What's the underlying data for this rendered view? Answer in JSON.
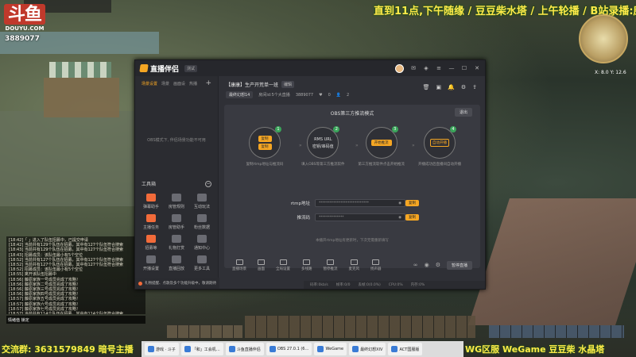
{
  "overlay": {
    "logo_big": "斗鱼",
    "logo_small": "DOUYU.COM",
    "room_id": "3889077",
    "ticker": "直到11点,下午随缘 / 豆豆柴水塔 / 上午轮播 / B站录播:康",
    "bottom_left": "交流群: 3631579849 暗号主播",
    "bottom_right": "WG区服 WeGame 豆豆柴 水晶塔",
    "coords": "X: 8.0 Y: 12.6"
  },
  "chat": {
    "lines": [
      "[18:42]「 」进入了队伍招募中，已提交申请",
      "[18:42] 当前共有129个队伍在招募，其中有127个队伍符合搜索",
      "[18:43] 当前共有129个队伍在招募，其中有127个队伍符合搜索",
      "[18:43] 招募成员：该队伍最小有5个空位",
      "[18:52] 当前共有127个队伍在招募，其中有127个队伍符合搜索",
      "[18:52] 当前共有127个队伍在招募，其中有127个队伍符合搜索",
      "[18:52] 招募成员：该队伍最小有5个空位",
      "[18:55] 离开该队伍招募中",
      "[18:56] 藤原家族一号成员完成了攻略！",
      "[18:56] 藤原家族二号成员完成了攻略！",
      "[18:56] 藤原家族三号成员完成了攻略！",
      "[18:56] 藤原家族四号成员完成了攻略！",
      "[18:57] 藤原家族五号成员完成了攻略！",
      "[18:57] 藤原家族六号成员完成了攻略！",
      "[18:57] 藤原家族七号成员完成了攻略！",
      "[18:57] 当前共有114个队伍在招募，其中有114个队伍符合搜索"
    ],
    "input_hint": "情绪值 锁定"
  },
  "taskbar": {
    "items": [
      "游戏 · 斗子",
      "「和」工会机…",
      "斗鱼直播伴侣",
      "OBS 27.0.1 (6…",
      "WeGame",
      "最终幻想XIV",
      "ACT国服版"
    ]
  },
  "app": {
    "name": "直播伴侣",
    "version": "测试",
    "sidebar_tabs": [
      "场景设置",
      "场景",
      "画面设",
      "热播"
    ],
    "obs_hint": "OBS模式下, 伴侣场景功能不可用",
    "tools_header": "工具箱",
    "tools": [
      {
        "label": "弹幕助手"
      },
      {
        "label": "房管规则"
      },
      {
        "label": "互动玩法"
      },
      {
        "label": "主播任务"
      },
      {
        "label": "房管助手"
      },
      {
        "label": "粉丝数据"
      },
      {
        "label": "招募等"
      },
      {
        "label": "礼物打赏"
      },
      {
        "label": "通知中心"
      },
      {
        "label": "开播设置"
      },
      {
        "label": "直播回放"
      },
      {
        "label": "更多工具"
      }
    ],
    "stream_title": "【康康】生产开荒单一班",
    "stream_tag": "编辑",
    "category": "最终幻想14",
    "room_label": "房间id:5个大直播",
    "room_number": "3889077",
    "likes": "0",
    "viewers": "2",
    "mode_title": "OBS第三方推流模式",
    "exit_label": "退出",
    "step1": {
      "num": "1",
      "btn_a": "复制",
      "btn_b": "复制",
      "desc": "复制rtmp地址与推流码"
    },
    "step2": {
      "num": "2",
      "line1": "RMS URL",
      "line2": "密钥/串码值",
      "desc": "填入OBS等第三方推流软件"
    },
    "step3": {
      "num": "3",
      "btn": "开始推流",
      "desc": "第三方推流软件点击开始推流"
    },
    "step4": {
      "num": "4",
      "box": "自动开播",
      "desc": "开播成功后直播间自动开播"
    },
    "rtmp_label": "rtmp地址",
    "rtmp_value": "****************************",
    "rtmp_copy": "复制",
    "key_label": "推流码",
    "key_value": "**************",
    "key_copy": "复制",
    "hint": "本播开rtmp地址有更新时，下次无需重新填写",
    "toolbar": [
      "直播场景",
      "画面",
      "全局设置",
      "多线路",
      "暂停推流",
      "麦克风",
      "扬声器"
    ],
    "end_label": "暂停直播",
    "status": [
      "码率:0kb/s",
      "帧率:0/0",
      "丢帧:0(0.0%)",
      "CPU:0%",
      "内存:0%"
    ],
    "notice": "礼物提醒、点歌及多个功能升级中，敬请期待"
  }
}
